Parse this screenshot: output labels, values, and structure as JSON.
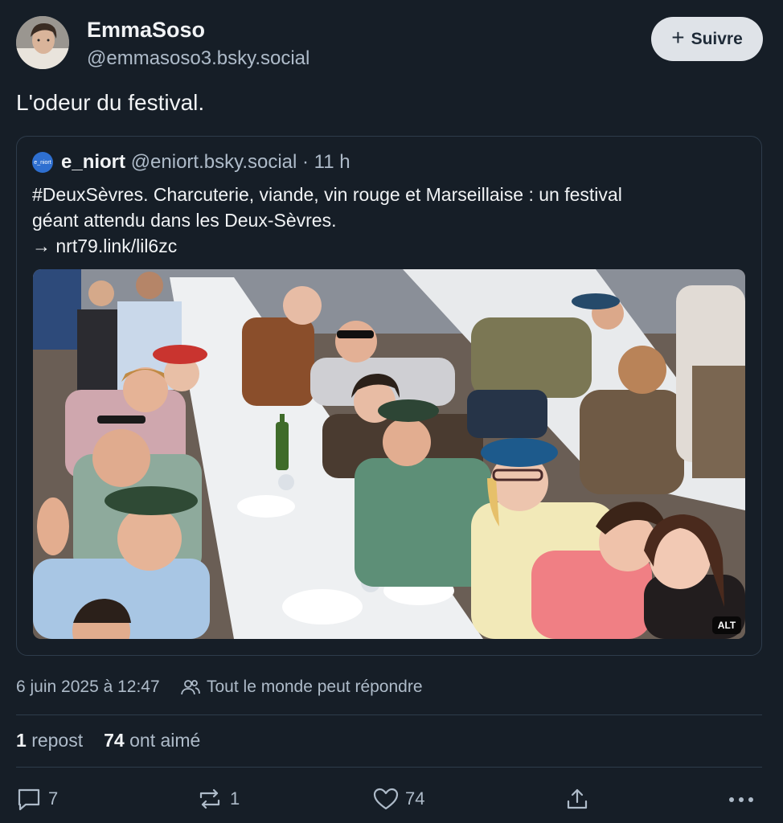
{
  "author": {
    "display_name": "EmmaSoso",
    "handle": "@emmasoso3.bsky.social"
  },
  "follow_button": {
    "label": "Suivre",
    "icon": "plus-icon"
  },
  "post": {
    "text": "L'odeur du festival."
  },
  "quote": {
    "avatar_text": "e_niort",
    "name": "e_niort",
    "meta": "@eniort.bsky.social · 11 h",
    "text_line1": "#DeuxSèvres. Charcuterie, viande, vin rouge et Marseillaise : un festival",
    "text_line2": "géant attendu dans les Deux-Sèvres.",
    "link": "→ nrt79.link/lil6zc",
    "image_alt_badge": "ALT"
  },
  "meta": {
    "timestamp": "6 juin 2025 à 12:47",
    "reply_setting": "Tout le monde peut répondre"
  },
  "stats": {
    "reposts_count": "1",
    "reposts_label": "repost",
    "likes_count": "74",
    "likes_label": "ont aimé"
  },
  "actions": {
    "reply_count": "7",
    "repost_count": "1",
    "like_count": "74"
  },
  "colors": {
    "background": "#161e27",
    "text_primary": "#f1f3f5",
    "text_secondary": "#aebbc9",
    "border": "#2e3c4b",
    "follow_button_bg": "#dfe3e8"
  }
}
